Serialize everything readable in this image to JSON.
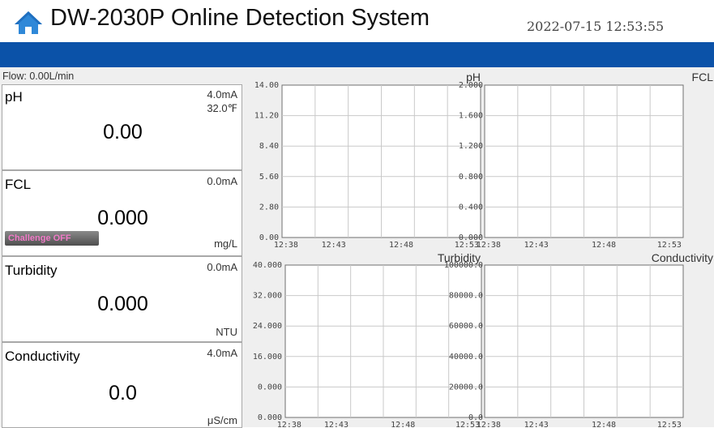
{
  "header": {
    "title": "DW-2030P Online Detection System",
    "datetime": "2022-07-15 12:53:55",
    "home_icon": "home-icon",
    "accent_color": "#0b52a8"
  },
  "flow": "Flow: 0.00L/min",
  "panels": [
    {
      "name": "pH",
      "current": "4.0mA",
      "temperature": "32.0℉",
      "value": "0.00",
      "unit": ""
    },
    {
      "name": "FCL",
      "current": "0.0mA",
      "value": "0.000",
      "unit": "mg/L",
      "button": "Challenge OFF"
    },
    {
      "name": "Turbidity",
      "current": "0.0mA",
      "value": "0.000",
      "unit": "NTU"
    },
    {
      "name": "Conductivity",
      "current": "4.0mA",
      "value": "0.0",
      "unit": "μS/cm"
    }
  ],
  "chart_data": [
    {
      "type": "line",
      "title": "pH",
      "y_ticks": [
        "14.00",
        "11.20",
        "8.40",
        "5.60",
        "2.80",
        "0.00"
      ],
      "x_ticks": [
        "12:38",
        "12:43",
        "12:48",
        "12:53"
      ],
      "ylim": [
        0,
        14
      ],
      "series": []
    },
    {
      "type": "line",
      "title": "FCL",
      "y_ticks": [
        "2.000",
        "1.600",
        "1.200",
        "0.800",
        "0.400",
        "0.000"
      ],
      "x_ticks": [
        "12:38",
        "12:43",
        "12:48",
        "12:53"
      ],
      "ylim": [
        0,
        2
      ],
      "series": []
    },
    {
      "type": "line",
      "title": "Turbidity",
      "y_ticks": [
        "40.000",
        "32.000",
        "24.000",
        "16.000",
        "0.000",
        "0.000"
      ],
      "x_ticks": [
        "12:38",
        "12:43",
        "12:48",
        "12:53"
      ],
      "ylim": [
        0,
        40
      ],
      "series": []
    },
    {
      "type": "line",
      "title": "Conductivity",
      "y_ticks": [
        "100000.0",
        "80000.0",
        "60000.0",
        "40000.0",
        "20000.0",
        "0.0"
      ],
      "x_ticks": [
        "12:38",
        "12:43",
        "12:48",
        "12:53"
      ],
      "ylim": [
        0,
        100000
      ],
      "series": []
    }
  ]
}
